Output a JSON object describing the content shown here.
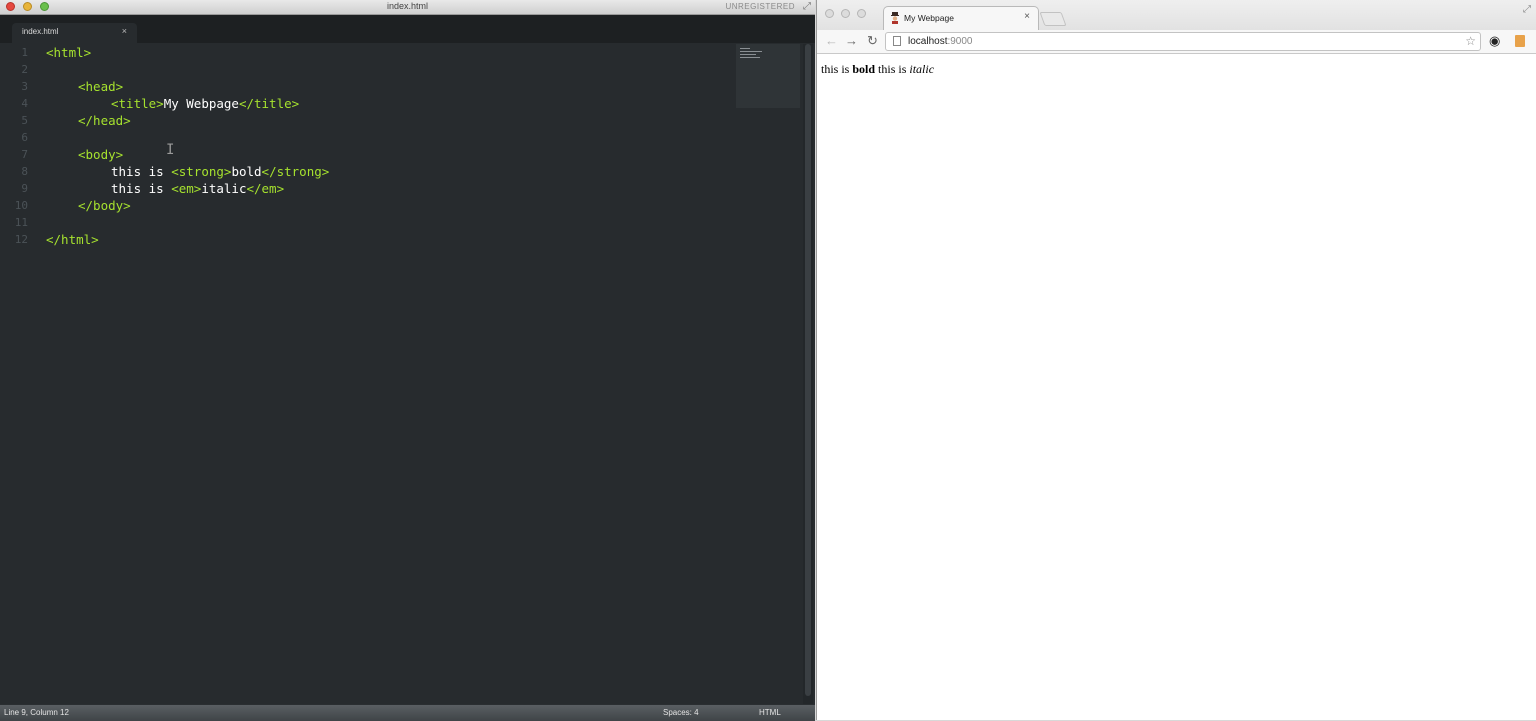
{
  "editor": {
    "window_title": "index.html",
    "unregistered_label": "UNREGISTERED",
    "tab": {
      "label": "index.html",
      "close_glyph": "×"
    },
    "line_numbers": [
      "1",
      "2",
      "3",
      "4",
      "5",
      "6",
      "7",
      "8",
      "9",
      "10",
      "11",
      "12"
    ],
    "code": {
      "l1_open": "<html>",
      "l3_open": "<head>",
      "l4_title_open": "<title>",
      "l4_title_text": "My Webpage",
      "l4_title_close": "</title>",
      "l5_close": "</head>",
      "l7_open": "<body>",
      "l8_text": "this is ",
      "l8_strong_open": "<strong>",
      "l8_strong_text": "bold",
      "l8_strong_close": "</strong>",
      "l9_text": "this is ",
      "l9_em_open": "<em>",
      "l9_em_text": "italic",
      "l9_em_close": "</em>",
      "l10_close": "</body>",
      "l12_close": "</html>"
    },
    "status": {
      "position": "Line 9, Column 12",
      "spaces": "Spaces: 4",
      "syntax": "HTML"
    }
  },
  "browser": {
    "tab_title": "My Webpage",
    "tab_close": "×",
    "url_host": "localhost",
    "url_port": ":9000",
    "content": {
      "text1": "this is ",
      "bold": "bold",
      "text2": " this is ",
      "italic": "italic"
    }
  },
  "colors": {
    "editor_bg": "#272b2e",
    "tag": "#a6e22e",
    "text": "#ffffff"
  }
}
